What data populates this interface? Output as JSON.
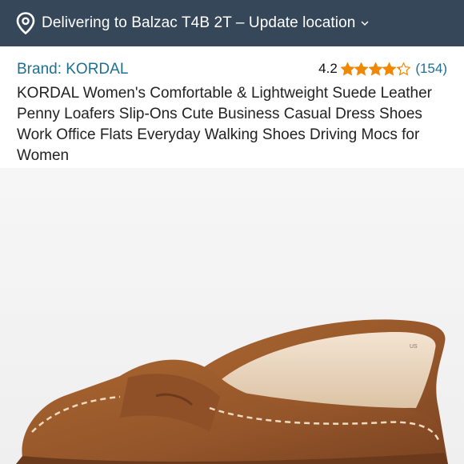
{
  "location": {
    "text": "Delivering to Balzac T4B 2T – Update location",
    "icon": "location-pin-icon"
  },
  "product": {
    "brand": "Brand: KORDAL",
    "rating": "4.2",
    "rating_count": "(154)",
    "stars": 4.2,
    "title": "KORDAL Women's Comfortable & Lightweight Suede Leather Penny Loafers Slip-Ons Cute Business Casual Dress Shoes Work Office Flats Everyday Walking Shoes Driving Mocs for Women"
  },
  "colors": {
    "header_bg": "#37475a",
    "link": "#1f6f91",
    "star": "#f08804",
    "shoe": "#9a5a2c"
  }
}
